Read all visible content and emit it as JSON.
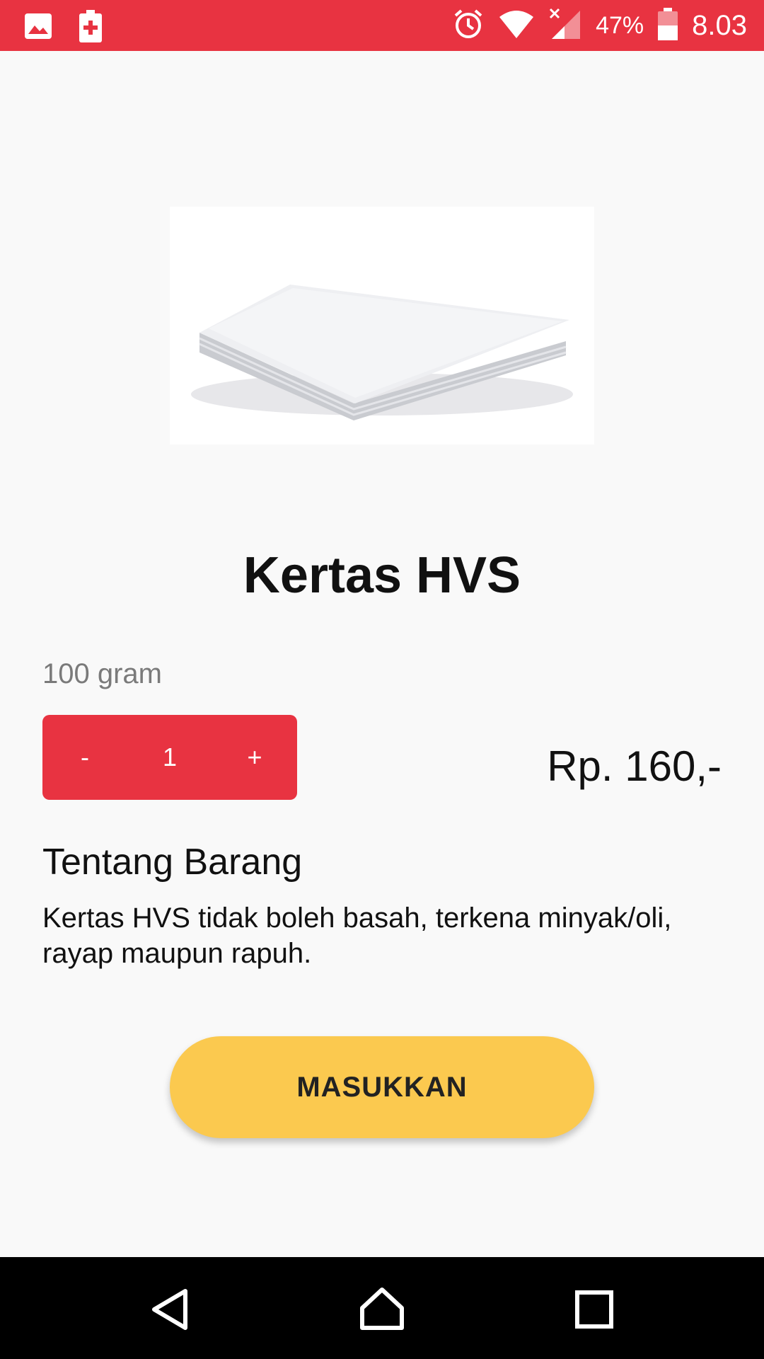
{
  "status_bar": {
    "battery_percent": "47%",
    "time": "8.03",
    "icons": [
      "gallery-icon",
      "battery-saver-icon",
      "alarm-icon",
      "wifi-icon",
      "signal-icon",
      "battery-icon"
    ]
  },
  "product": {
    "image_icon": "paper-stack-image",
    "title": "Kertas HVS",
    "weight": "100 gram",
    "quantity": {
      "decrement_label": "-",
      "value": "1",
      "increment_label": "+"
    },
    "price": "Rp. 160,-"
  },
  "about": {
    "heading": "Tentang Barang",
    "text": "Kertas HVS tidak boleh basah, terkena minyak/oli, rayap maupun rapuh."
  },
  "actions": {
    "add_label": "MASUKKAN"
  },
  "nav_bar": {
    "icons": [
      "back-icon",
      "home-icon",
      "recents-icon"
    ]
  },
  "colors": {
    "accent": "#e83341",
    "button": "#fbc94f"
  }
}
